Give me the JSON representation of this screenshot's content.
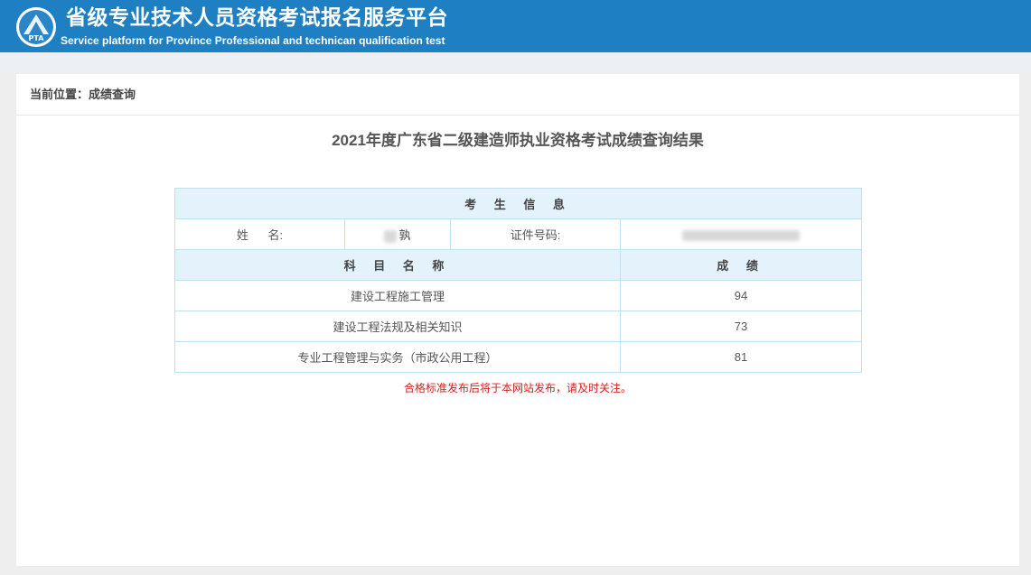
{
  "header": {
    "title": "省级专业技术人员资格考试报名服务平台",
    "subtitle": "Service platform for Province Professional and technican qualification test",
    "logo_text": "PTA"
  },
  "breadcrumb": {
    "text": "当前位置：成绩查询"
  },
  "page_title": "2021年度广东省二级建造师执业资格考试成绩查询结果",
  "candidate": {
    "section_title": "考 生 信 息",
    "name_label": "姓      名:",
    "name_value_visible": "孰",
    "id_label": "证件号码:"
  },
  "results": {
    "col_subject": "科 目 名 称",
    "col_score": "成 绩",
    "rows": [
      {
        "subject": "建设工程施工管理",
        "score": "94"
      },
      {
        "subject": "建设工程法规及相关知识",
        "score": "73"
      },
      {
        "subject": "专业工程管理与实务（市政公用工程）",
        "score": "81"
      }
    ]
  },
  "notice": "合格标准发布后将于本网站发布，请及时关注。",
  "colors": {
    "header_bg": "#1e7fc3",
    "table_head_bg": "#e4f2fb",
    "table_border": "#bfe0f1",
    "notice_red": "#d42020"
  }
}
